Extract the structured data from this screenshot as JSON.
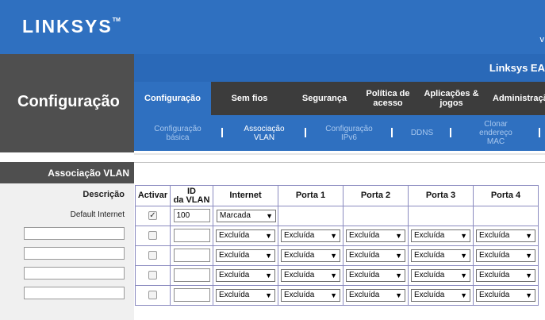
{
  "brand": {
    "logo": "LINKSYS",
    "tm": "TM"
  },
  "header": {
    "right_fragment": "v",
    "model": "Linksys EA"
  },
  "section_title": "Configuração",
  "tabs": [
    {
      "label": "Configuração",
      "active": true
    },
    {
      "label": "Sem fios"
    },
    {
      "label": "Segurança"
    },
    {
      "label": "Política de acesso"
    },
    {
      "label": "Aplicações & jogos"
    },
    {
      "label": "Administração"
    }
  ],
  "subtabs": [
    {
      "label": "Configuração básica"
    },
    {
      "label": "Associação VLAN",
      "active": true
    },
    {
      "label": "Configuração IPv6"
    },
    {
      "label": "DDNS"
    },
    {
      "label": "Clonar endereço MAC"
    }
  ],
  "panel": {
    "title": "Associação VLAN",
    "description_label": "Descrição",
    "default_label": "Default Internet"
  },
  "table": {
    "headers": {
      "activar": "Activar",
      "id": "ID da VLAN",
      "internet": "Internet",
      "porta1": "Porta 1",
      "porta2": "Porta 2",
      "porta3": "Porta 3",
      "porta4": "Porta 4"
    },
    "row0": {
      "checked": true,
      "id": "100",
      "internet": "Marcada"
    },
    "excluded_label": "Excluída",
    "check_mark": "✓"
  },
  "colors": {
    "brand_blue": "#2f70c0",
    "dark_gray": "#4f4f4f",
    "tab_bar": "#3c3c3c"
  }
}
